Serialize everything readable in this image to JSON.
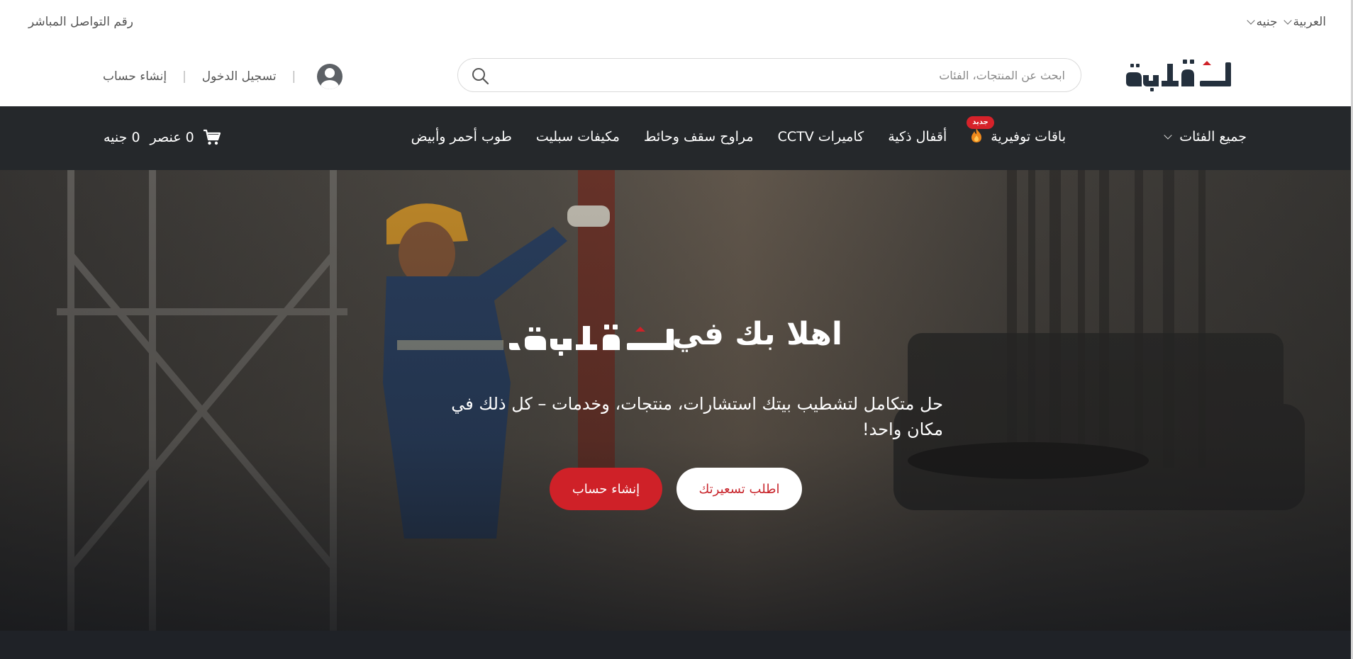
{
  "topbar": {
    "contact_label": "رقم التواصل المباشر",
    "language": "العربية",
    "currency": "جنيه"
  },
  "header": {
    "logo_text": "تشطيبة",
    "search": {
      "placeholder": "ابحث عن المنتجات، الفئات",
      "value": ""
    },
    "login_label": "تسجيل الدخول",
    "signup_label": "إنشاء حساب"
  },
  "nav": {
    "all_categories_label": "جميع الفئات",
    "items": [
      {
        "label": "باقات توفيرية",
        "badge": "جديد"
      },
      {
        "label": "أقفال ذكية"
      },
      {
        "label": "كاميرات CCTV"
      },
      {
        "label": "مراوح سقف وحائط"
      },
      {
        "label": "مكيفات سبليت"
      },
      {
        "label": "طوب أحمر وأبيض"
      }
    ],
    "cart": {
      "count": "0 عنصر",
      "total": "0 جنيه"
    }
  },
  "hero": {
    "title": "اهلا بك في",
    "subtitle": "حل متكامل لتشطيب بيتك استشارات، منتجات، وخدمات – كل ذلك في مكان واحد!",
    "quote_button": "اطلب تسعيرتك",
    "signup_button": "إنشاء حساب"
  },
  "colors": {
    "brand_red": "#cf2128",
    "nav_bg": "#25282b",
    "logo_dark": "#24303d"
  }
}
